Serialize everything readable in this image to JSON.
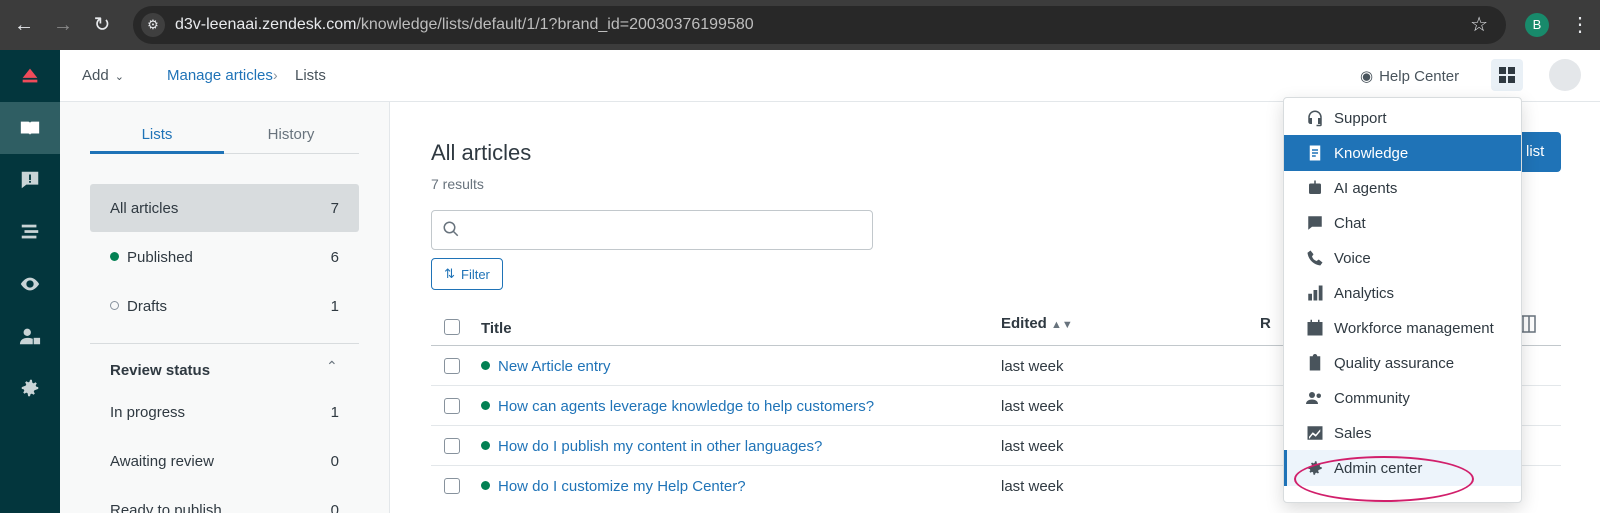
{
  "browser": {
    "url_host": "d3v-leenaai.zendesk.com",
    "url_path": "/knowledge/lists/default/1/1?brand_id=20030376199580",
    "profile_initial": "B"
  },
  "header": {
    "add_label": "Add",
    "breadcrumb_parent": "Manage articles",
    "breadcrumb_current": "Lists",
    "help_center_label": "Help Center"
  },
  "sidebar": {
    "tabs": [
      "Lists",
      "History"
    ],
    "lists": [
      {
        "label": "All articles",
        "count": "7"
      },
      {
        "label": "Published",
        "count": "6"
      },
      {
        "label": "Drafts",
        "count": "1"
      }
    ],
    "review_title": "Review status",
    "review": [
      {
        "label": "In progress",
        "count": "1"
      },
      {
        "label": "Awaiting review",
        "count": "0"
      },
      {
        "label": "Ready to publish",
        "count": "0"
      }
    ]
  },
  "main": {
    "title": "All articles",
    "results": "7 results",
    "search_placeholder": "",
    "filter_label": "Filter",
    "new_list_label": "list",
    "columns": {
      "title": "Title",
      "edited": "Edited",
      "r": "R"
    },
    "rows": [
      {
        "title": "New Article entry",
        "edited": "last week"
      },
      {
        "title": "How can agents leverage knowledge to help customers?",
        "edited": "last week"
      },
      {
        "title": "How do I publish my content in other languages?",
        "edited": "last week"
      },
      {
        "title": "How do I customize my Help Center?",
        "edited": "last week"
      }
    ]
  },
  "product_menu": {
    "items": [
      {
        "label": "Support",
        "icon": "headset-icon"
      },
      {
        "label": "Knowledge",
        "icon": "book-icon"
      },
      {
        "label": "AI agents",
        "icon": "robot-icon"
      },
      {
        "label": "Chat",
        "icon": "chat-icon"
      },
      {
        "label": "Voice",
        "icon": "phone-icon"
      },
      {
        "label": "Analytics",
        "icon": "bar-chart-icon"
      },
      {
        "label": "Workforce management",
        "icon": "calendar-icon"
      },
      {
        "label": "Quality assurance",
        "icon": "clipboard-check-icon"
      },
      {
        "label": "Community",
        "icon": "people-icon"
      },
      {
        "label": "Sales",
        "icon": "trend-icon"
      },
      {
        "label": "Admin center",
        "icon": "gear-icon"
      }
    ],
    "active_item": "Knowledge",
    "highlighted_item": "Admin center"
  },
  "colors": {
    "accent": "#1f73b7",
    "nav_bg": "#03363d",
    "highlight_ring": "#d11f6b"
  }
}
